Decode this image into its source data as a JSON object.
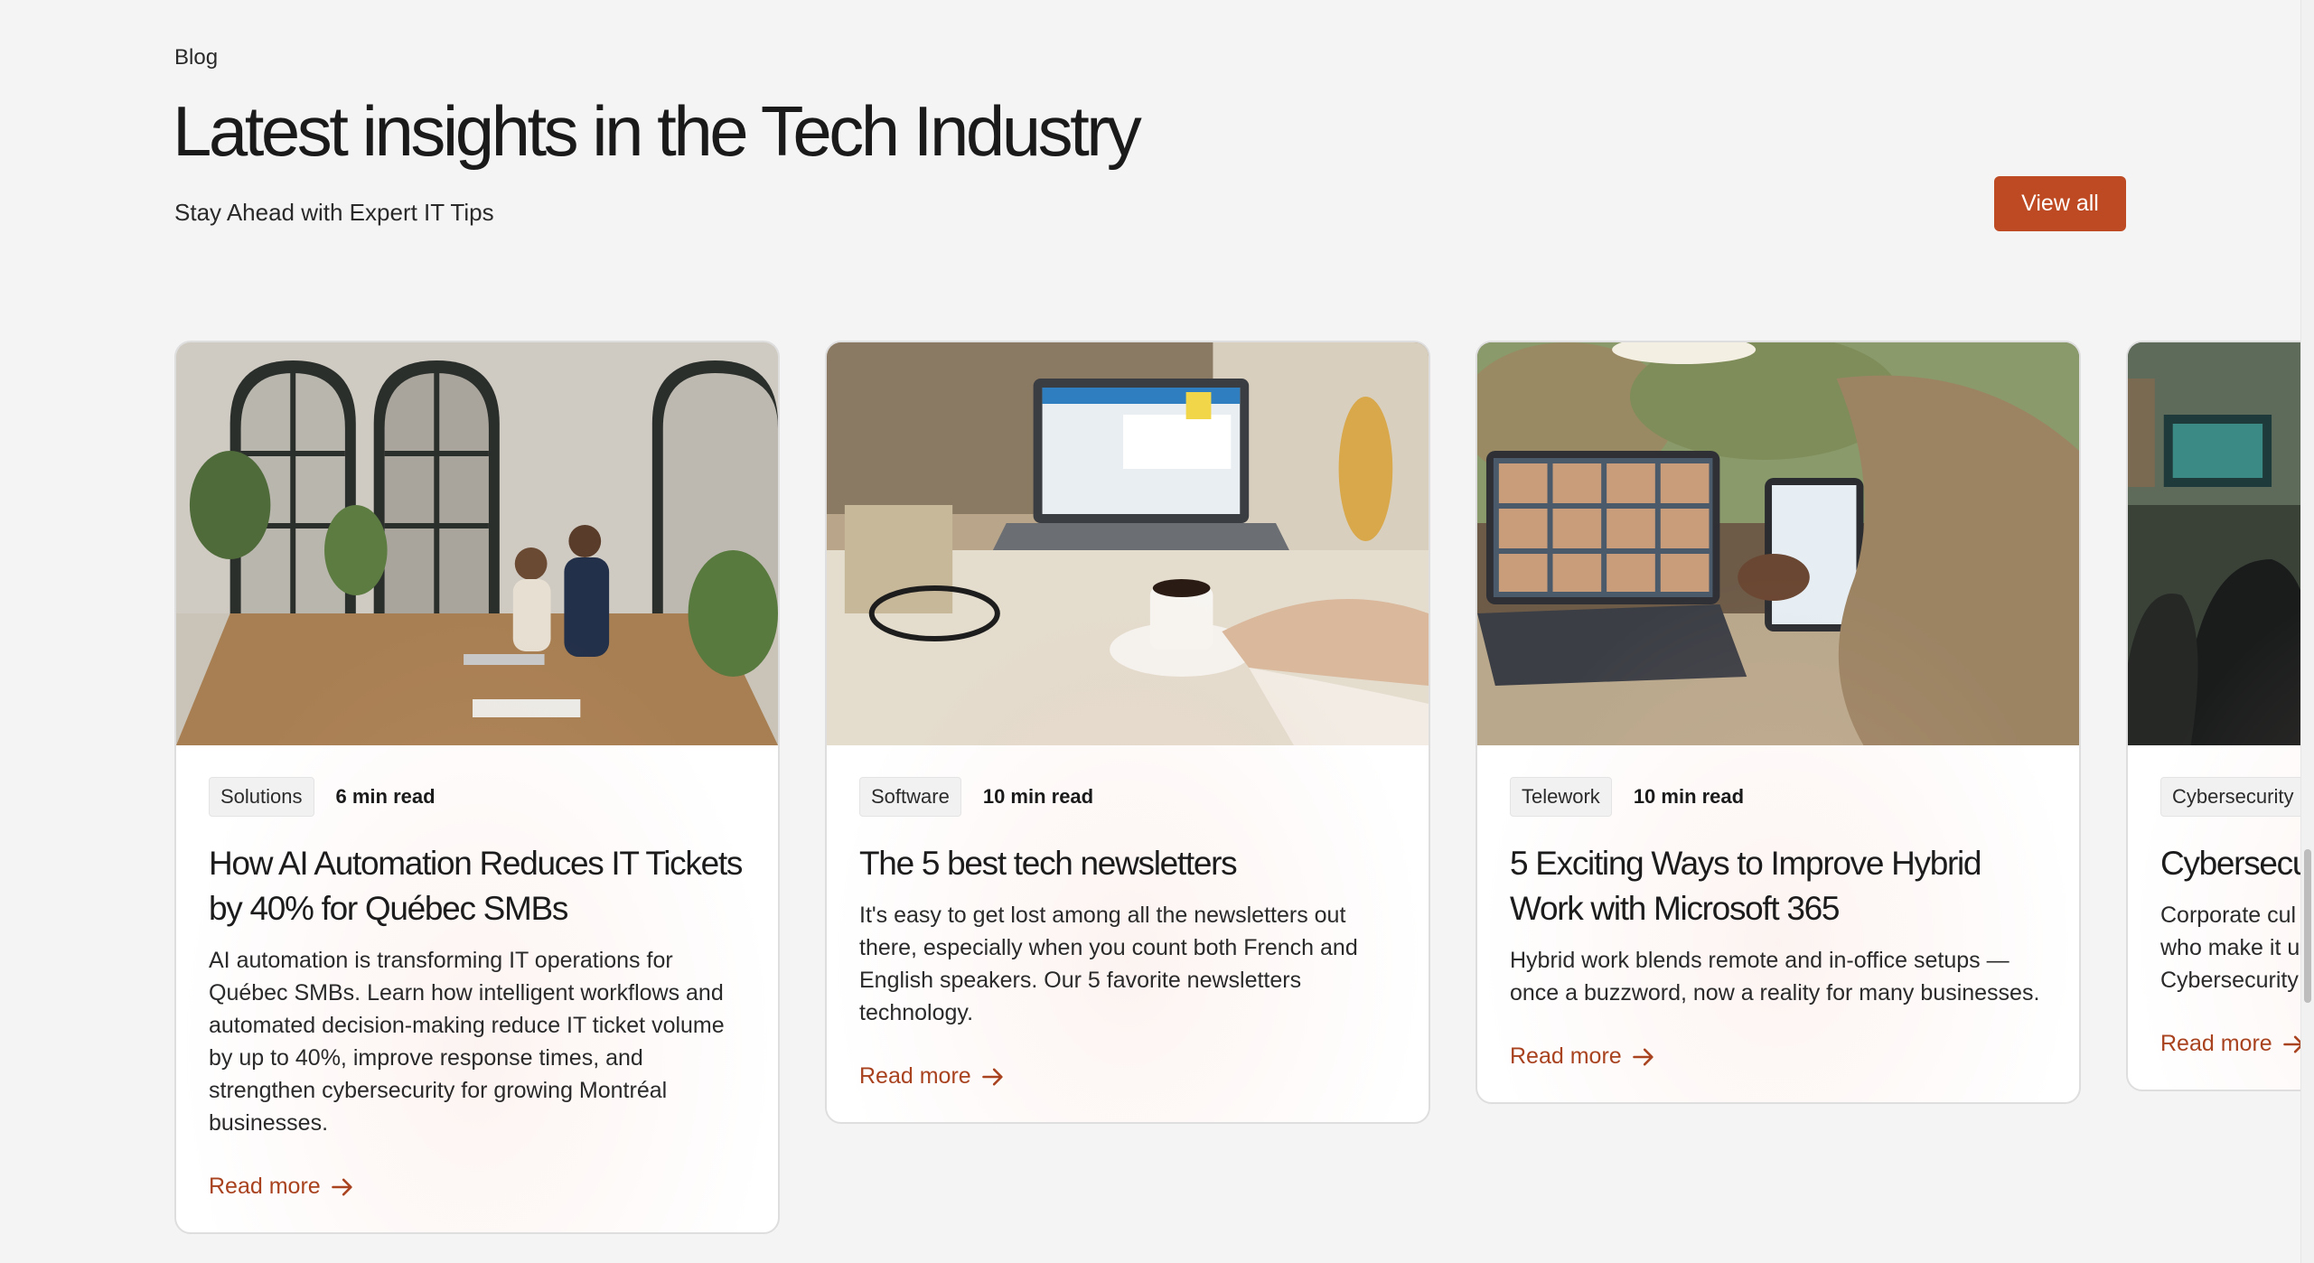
{
  "section": {
    "eyebrow": "Blog",
    "title": "Latest insights in the Tech Industry",
    "subtitle": "Stay Ahead with Expert IT Tips",
    "view_all_label": "View all"
  },
  "colors": {
    "accent": "#bd4a22",
    "link": "#a8421f",
    "background": "#f4f4f4"
  },
  "cards": [
    {
      "tag": "Solutions",
      "read_time": "6 min read",
      "title": "How AI Automation Reduces IT Tickets by 40% for Québec SMBs",
      "description": "AI automation is transforming IT operations for Québec SMBs. Learn how intelligent workflows and automated decision-making reduce IT ticket volume by up to 40%, improve response times, and strengthen cybersecurity for growing Montréal businesses.",
      "read_more": "Read more",
      "image": "office-meeting-photo"
    },
    {
      "tag": "Software",
      "read_time": "10 min read",
      "title": "The 5 best tech newsletters",
      "description": "It's easy to get lost among all the newsletters out there, especially when you count both French and English speakers. Our 5 favorite newsletters technology.",
      "read_more": "Read more",
      "image": "laptop-coffee-photo"
    },
    {
      "tag": "Telework",
      "read_time": "10 min read",
      "title": "5 Exciting Ways to Improve Hybrid Work with Microsoft 365",
      "description": "Hybrid work blends remote and in-office setups — once a buzzword, now a reality for many businesses.",
      "read_more": "Read more",
      "image": "video-call-photo"
    },
    {
      "tag": "Cybersecurity",
      "read_time": "",
      "title": "Cybersecu",
      "description": "Corporate cul who make it u Cybersecurity",
      "read_more": "Read more",
      "image": "security-office-photo"
    }
  ]
}
